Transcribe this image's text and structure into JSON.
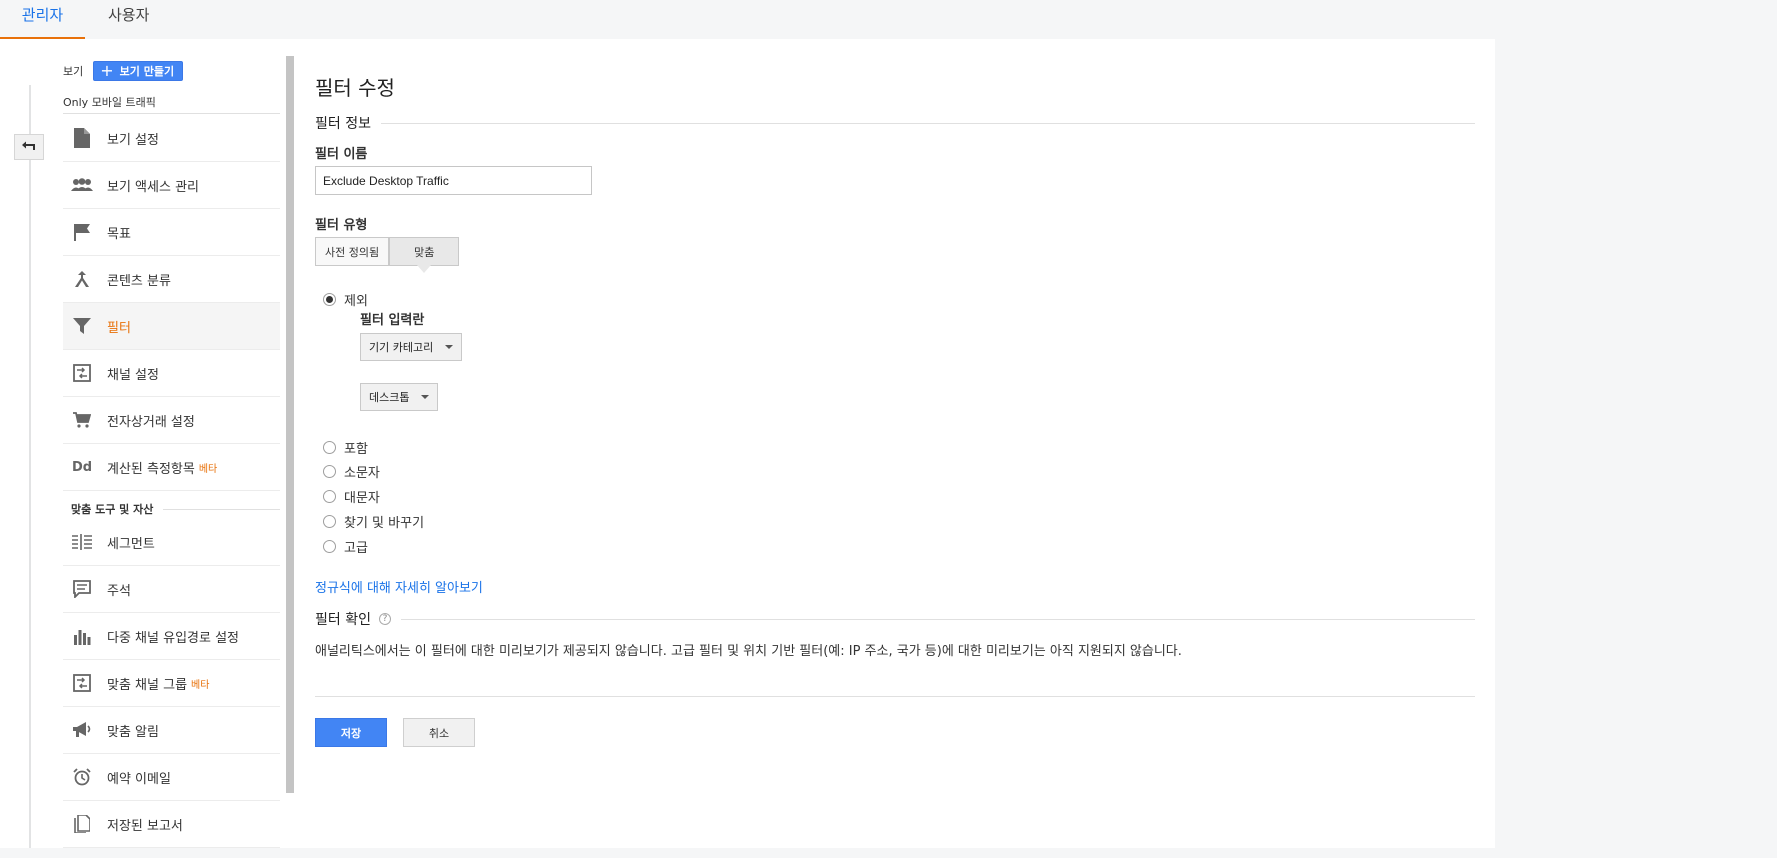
{
  "tabs": {
    "admin": "관리자",
    "user": "사용자"
  },
  "sidebar": {
    "view_label": "보기",
    "create_view_label": "보기 만들기",
    "view_name": "Only 모바일 트래픽",
    "items": [
      {
        "label": "보기 설정",
        "icon": "document-icon"
      },
      {
        "label": "보기 액세스 관리",
        "icon": "people-icon"
      },
      {
        "label": "목표",
        "icon": "flag-icon"
      },
      {
        "label": "콘텐츠 분류",
        "icon": "merge-icon"
      },
      {
        "label": "필터",
        "icon": "filter-icon"
      },
      {
        "label": "채널 설정",
        "icon": "channel-settings-icon"
      },
      {
        "label": "전자상거래 설정",
        "icon": "cart-icon"
      },
      {
        "label": "계산된 측정항목",
        "icon": "dd-icon",
        "beta": "베타"
      }
    ],
    "section2_title": "맞춤 도구 및 자산",
    "items2": [
      {
        "label": "세그먼트",
        "icon": "segment-icon"
      },
      {
        "label": "주석",
        "icon": "comment-icon"
      },
      {
        "label": "다중 채널 유입경로 설정",
        "icon": "bar-chart-icon"
      },
      {
        "label": "맞춤 채널 그룹",
        "icon": "channel-group-icon",
        "beta": "베타"
      },
      {
        "label": "맞춤 알림",
        "icon": "megaphone-icon"
      },
      {
        "label": "예약 이메일",
        "icon": "alarm-clock-icon"
      },
      {
        "label": "저장된 보고서",
        "icon": "saved-report-icon"
      }
    ]
  },
  "main": {
    "title": "필터 수정",
    "info_section": "필터 정보",
    "name_label": "필터 이름",
    "name_value": "Exclude Desktop Traffic",
    "type_label": "필터 유형",
    "type_predefined": "사전 정의됨",
    "type_custom": "맞춤",
    "exclude_label": "제외",
    "filter_field_label": "필터 입력란",
    "field_dropdown": "기기 카테고리",
    "value_dropdown": "데스크톱",
    "include_label": "포함",
    "lowercase_label": "소문자",
    "uppercase_label": "대문자",
    "search_replace_label": "찾기 및 바꾸기",
    "advanced_label": "고급",
    "regex_link": "정규식에 대해 자세히 알아보기",
    "verify_section": "필터 확인",
    "help_glyph": "?",
    "verify_text": "애널리틱스에서는 이 필터에 대한 미리보기가 제공되지 않습니다. 고급 필터 및 위치 기반 필터(예: IP 주소, 국가 등)에 대한 미리보기는 아직 지원되지 않습니다.",
    "save_label": "저장",
    "cancel_label": "취소"
  },
  "colors": {
    "accent": "#4285f4",
    "active_tab": "#e8710a",
    "link": "#1a73e8"
  }
}
